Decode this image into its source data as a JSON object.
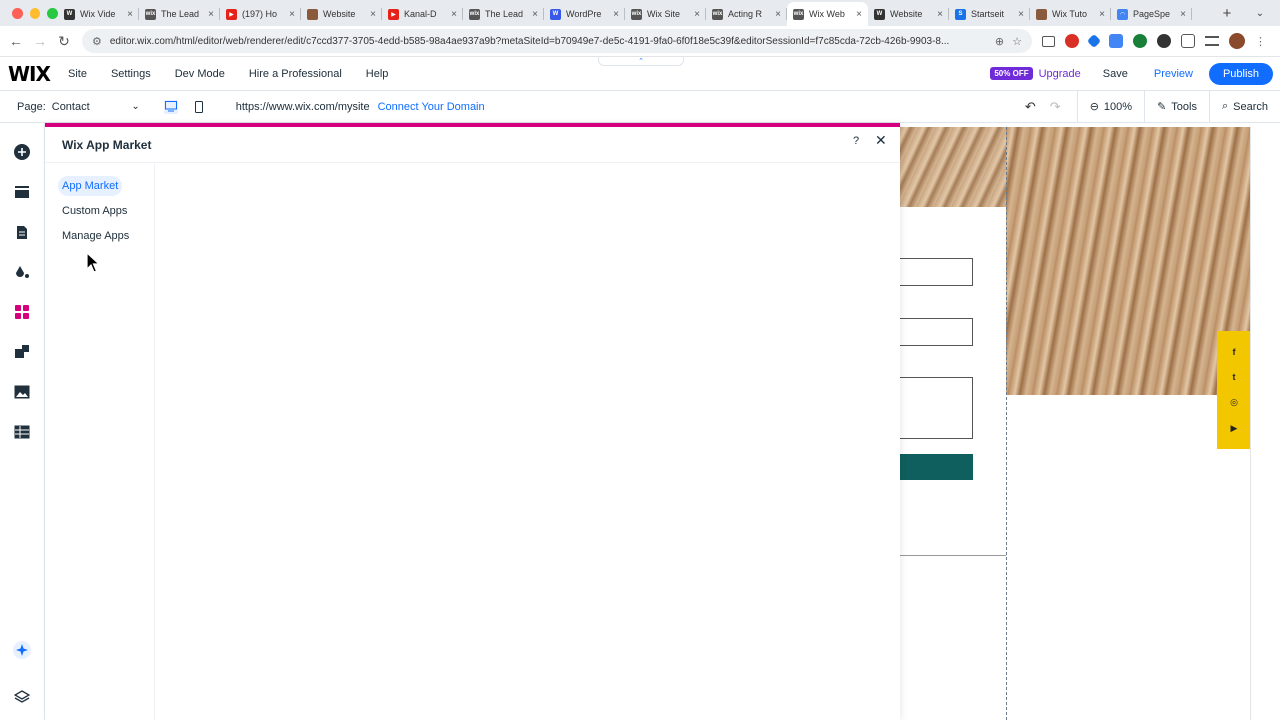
{
  "browser": {
    "tabs": [
      {
        "title": "Wix Vide",
        "fav_color": "#333333",
        "fav": "W"
      },
      {
        "title": "The Lead",
        "fav_color": "#555555",
        "fav": "wix"
      },
      {
        "title": "(197) Ho",
        "fav_color": "#e62117",
        "fav": "▶"
      },
      {
        "title": "Website",
        "fav_color": "#8a5a3c",
        "fav": ""
      },
      {
        "title": "Kanal-D",
        "fav_color": "#e62117",
        "fav": "▶"
      },
      {
        "title": "The Lead",
        "fav_color": "#555555",
        "fav": "wix"
      },
      {
        "title": "WordPre",
        "fav_color": "#3858e9",
        "fav": "W"
      },
      {
        "title": "Wix Site",
        "fav_color": "#555555",
        "fav": "wix"
      },
      {
        "title": "Acting R",
        "fav_color": "#555555",
        "fav": "wix"
      },
      {
        "title": "Wix Web",
        "fav_color": "#555555",
        "fav": "wix",
        "active": true
      },
      {
        "title": "Website",
        "fav_color": "#333333",
        "fav": "W"
      },
      {
        "title": "Startseit",
        "fav_color": "#1a73e8",
        "fav": "S"
      },
      {
        "title": "Wix Tuto",
        "fav_color": "#8a5a3c",
        "fav": ""
      },
      {
        "title": "PageSpe",
        "fav_color": "#4285f4",
        "fav": "◠"
      }
    ],
    "url": "editor.wix.com/html/editor/web/renderer/edit/c7ccd377-3705-4edd-b585-98a4ae937a9b?metaSiteId=b70949e7-de5c-4191-9fa0-6f0f18e5c39f&editorSessionId=f7c85cda-72cb-426b-9903-8..."
  },
  "wix_top": {
    "logo": "WIX",
    "menu": [
      "Site",
      "Settings",
      "Dev Mode",
      "Hire a Professional",
      "Help"
    ],
    "sale_badge": "50% OFF",
    "upgrade": "Upgrade",
    "save": "Save",
    "preview": "Preview",
    "publish": "Publish"
  },
  "wix_sub": {
    "page_label": "Page:",
    "page_value": "Contact",
    "site_url": "https://www.wix.com/mysite",
    "connect_domain": "Connect Your Domain",
    "zoom": "100%",
    "tools": "Tools",
    "search": "Search"
  },
  "panel": {
    "title": "Wix App Market",
    "help": "?",
    "nav": [
      {
        "label": "App Market",
        "active": true
      },
      {
        "label": "Custom Apps",
        "active": false
      },
      {
        "label": "Manage Apps",
        "active": false
      }
    ]
  },
  "canvas": {
    "social": [
      "f",
      "t",
      "◎",
      "▶"
    ]
  },
  "colors": {
    "accent_blue": "#116dff",
    "upgrade_purple": "#6f2bd9",
    "panel_accent": "#d4007f",
    "social_yellow": "#f2c700",
    "form_button": "#0f5f5e"
  }
}
